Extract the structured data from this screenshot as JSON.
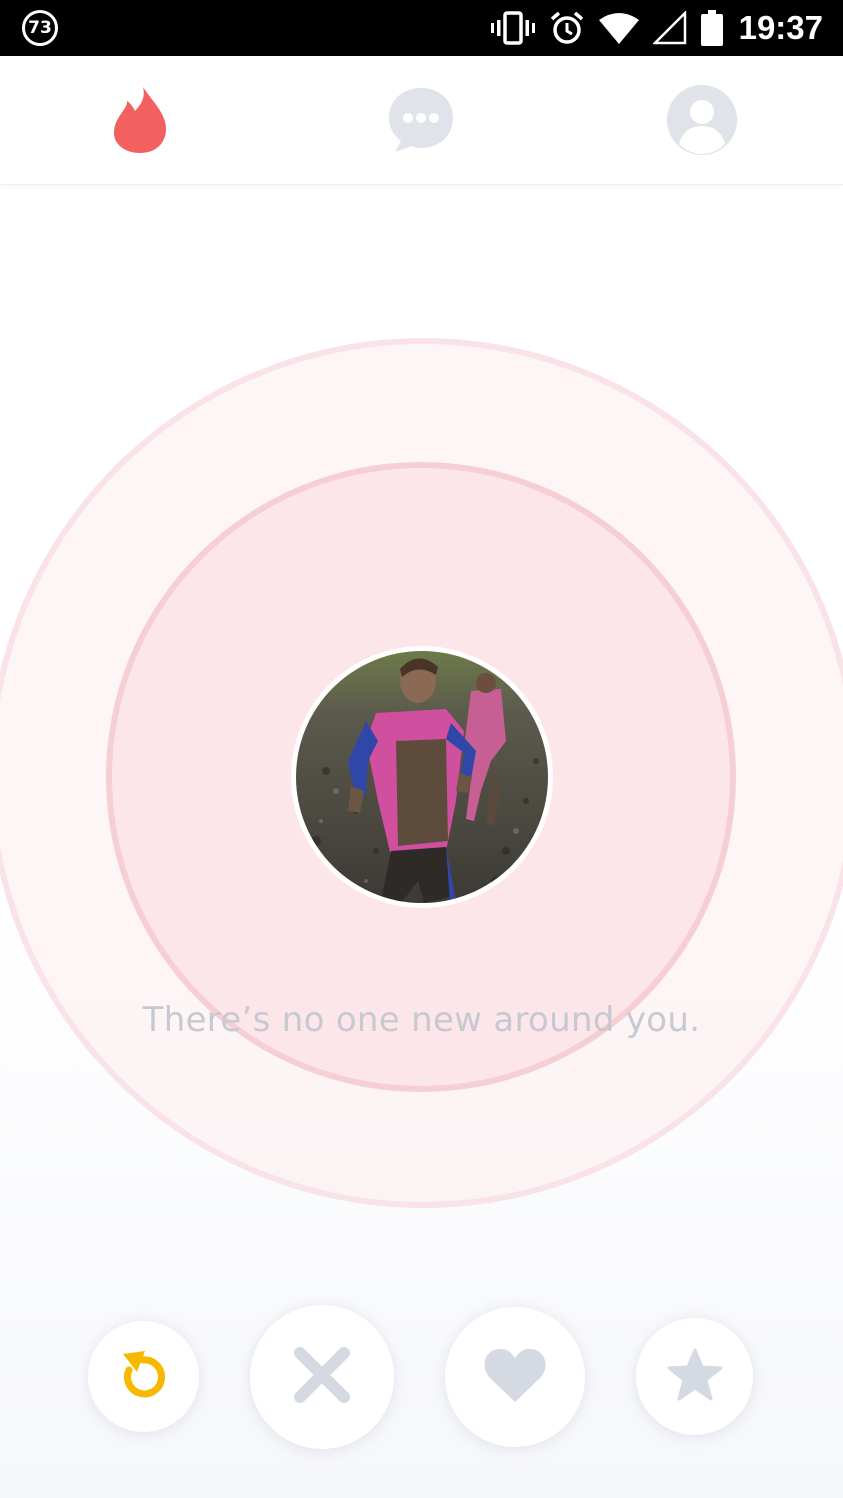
{
  "status_bar": {
    "notification_count": "73",
    "time": "19:37",
    "icons": [
      "vibrate-icon",
      "alarm-icon",
      "wifi-icon",
      "cell-signal-icon",
      "battery-icon"
    ]
  },
  "nav": {
    "tabs": [
      {
        "icon": "flame-icon",
        "active": true
      },
      {
        "icon": "messages-icon",
        "active": false
      },
      {
        "icon": "profile-icon",
        "active": false
      }
    ],
    "active_color": "#f2615f",
    "inactive_color": "#e1e3ea"
  },
  "main": {
    "empty_message": "There’s no one new around you.",
    "avatar": "user-photo"
  },
  "actions": [
    {
      "icon": "rewind-icon",
      "color": "#f6b900"
    },
    {
      "icon": "nope-icon",
      "color": "#d5d9e2"
    },
    {
      "icon": "like-icon",
      "color": "#d5d9e2"
    },
    {
      "icon": "super-like-icon",
      "color": "#d5d9e2"
    }
  ]
}
